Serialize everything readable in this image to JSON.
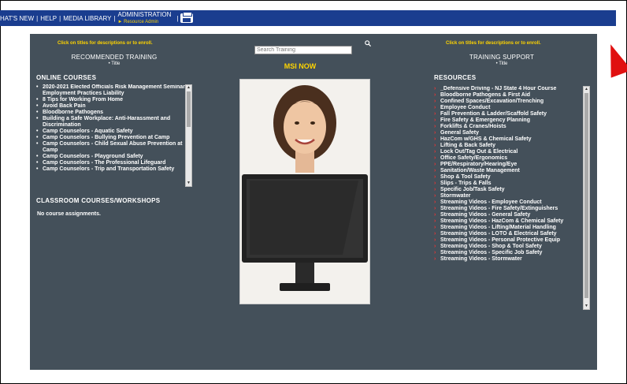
{
  "topbar": {
    "whats_new": "HAT'S NEW",
    "help": "HELP",
    "media_library": "MEDIA LIBRARY",
    "administration": "ADMINISTRATION",
    "resource_admin": "► Resource Admin",
    "sep": "|"
  },
  "left": {
    "hint": "Click on titles for descriptions or to enroll.",
    "title": "RECOMMENDED TRAINING",
    "subtitle": "• Title",
    "online_heading": "ONLINE COURSES",
    "online_courses": [
      "2020-2021 Elected Officials Risk Management Seminar: Employment Practices Liability",
      "8 Tips for Working From Home",
      "Avoid Back Pain",
      "Bloodborne Pathogens",
      "Building a Safe Workplace: Anti-Harassment and Discrimination",
      "Camp Counselors - Aquatic Safety",
      "Camp Counselors - Bullying Prevention at Camp",
      "Camp Counselors - Child Sexual Abuse Prevention at Camp",
      "Camp Counselors - Playground Safety",
      "Camp Counselors - The Professional Lifeguard",
      "Camp Counselors - Trip and Transportation Safety"
    ],
    "classroom_heading": "CLASSROOM COURSES/WORKSHOPS",
    "no_assign": "No course assignments."
  },
  "center": {
    "search_placeholder": "Search Training",
    "msi_now": "MSI NOW"
  },
  "right": {
    "hint": "Click on titles for descriptions or to enroll.",
    "title": "TRAINING SUPPORT",
    "subtitle": "• Title",
    "resources_heading": "RESOURCES",
    "resources": [
      "_Defensive Driving - NJ State 4 Hour Course",
      "Bloodborne Pathogens & First Aid",
      "Confined Spaces/Excavation/Trenching",
      "Employee Conduct",
      "Fall Prevention & Ladder/Scaffold Safety",
      "Fire Safety & Emergency Planning",
      "Forklifts & Cranes/Hoists",
      "General Safety",
      "HazCom w/GHS & Chemical Safety",
      "Lifting & Back Safety",
      "Lock Out/Tag Out & Electrical",
      "Office Safety/Ergonomics",
      "PPE/Respiratory/Hearing/Eye",
      "Sanitation/Waste Management",
      "Shop & Tool Safety",
      "Slips - Trips & Falls",
      "Specific Job/Task Safety",
      "Stormwater",
      "Streaming Videos - Employee Conduct",
      "Streaming Videos - Fire Safety/Extinguishers",
      "Streaming Videos - General Safety",
      "Streaming Videos - HazCom & Chemical Safety",
      "Streaming Videos - Lifting/Material Handling",
      "Streaming Videos - LOTO & Electrical Safety",
      "Streaming Videos - Personal Protective Equip",
      "Streaming Videos - Shop & Tool Safety",
      "Streaming Videos - Specific Job Safety",
      "Streaming Videos - Stormwater"
    ]
  },
  "colors": {
    "topbar": "#1a3d8f",
    "panel": "#44505a",
    "accent": "#ffd400",
    "arrow": "#e01010"
  }
}
